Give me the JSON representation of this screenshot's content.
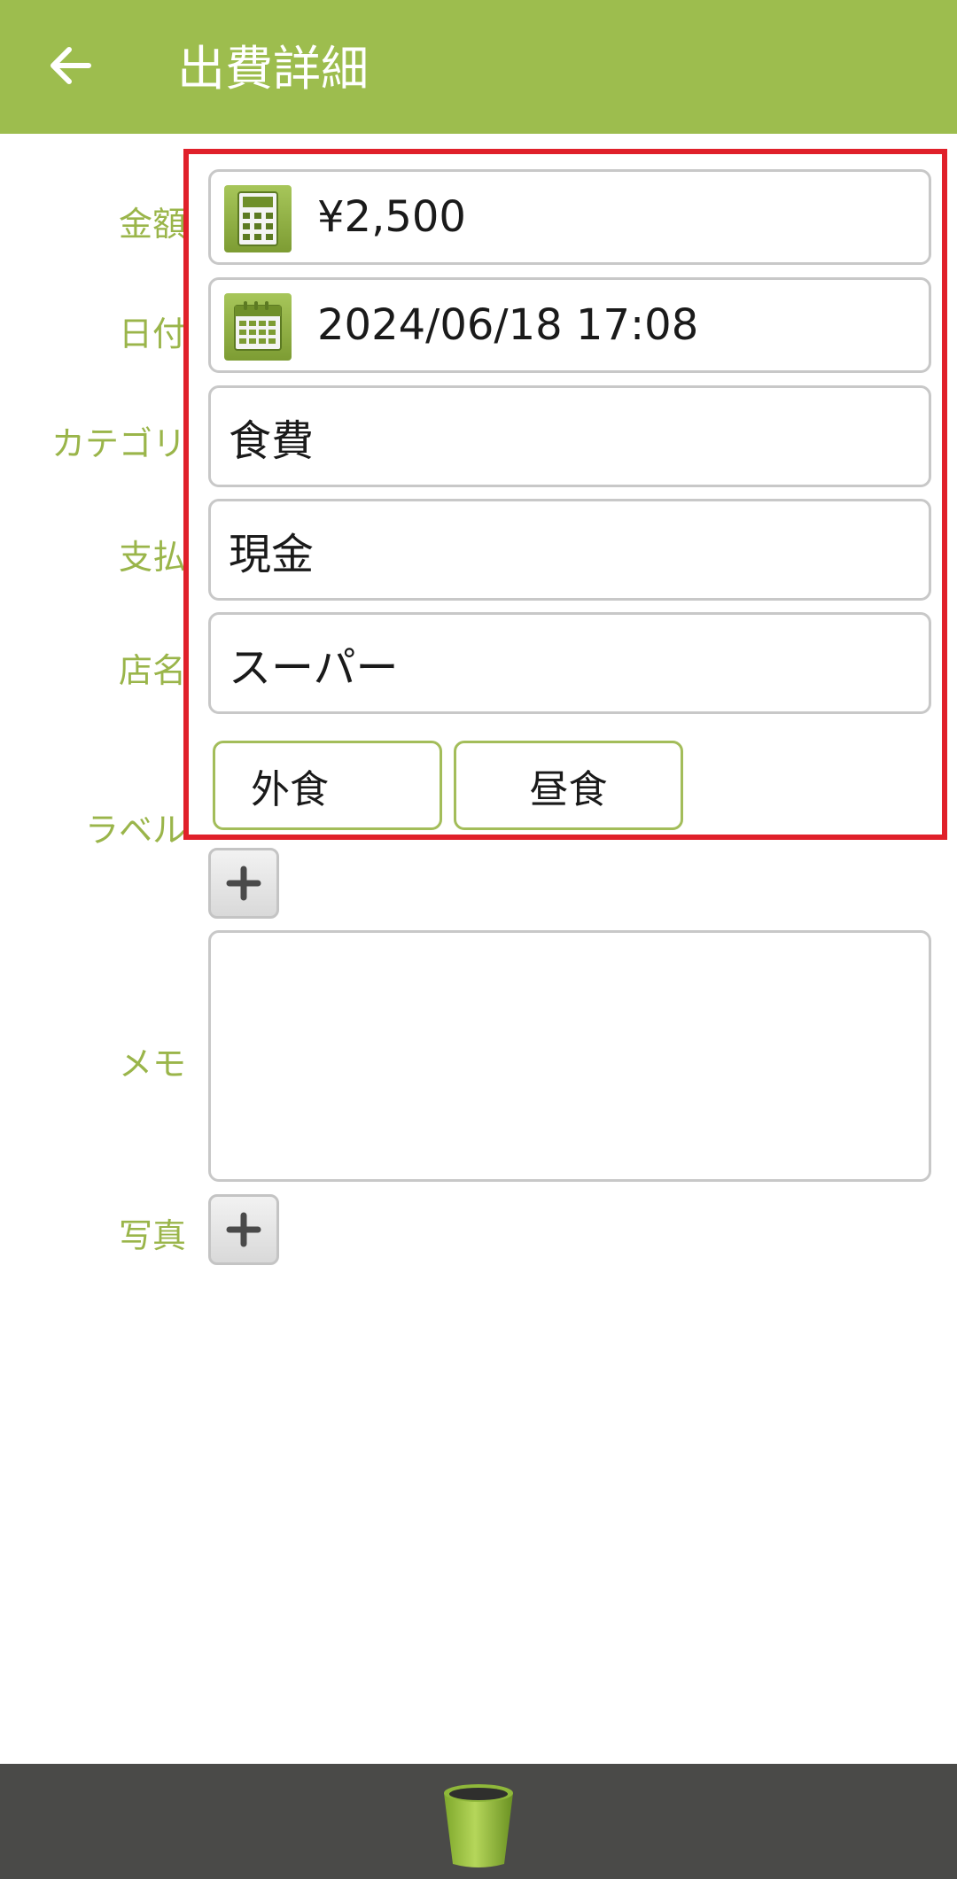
{
  "header": {
    "title": "出費詳細",
    "back_icon": "arrow-left-icon",
    "background_color": "#9dbd4e"
  },
  "form": {
    "labels": {
      "amount": "金額",
      "date": "日付",
      "category": "カテゴリ",
      "payment": "支払",
      "store": "店名",
      "label": "ラベル",
      "memo": "メモ",
      "photo": "写真"
    },
    "amount": {
      "value": "¥2,500",
      "icon": "calculator-icon"
    },
    "date": {
      "value": "2024/06/18 17:08",
      "icon": "calendar-icon"
    },
    "category": {
      "value": "食費"
    },
    "payment": {
      "value": "現金"
    },
    "store": {
      "value": "スーパー"
    },
    "tags": [
      "外食",
      "昼食"
    ],
    "add_label_icon": "plus-icon",
    "memo": {
      "value": ""
    },
    "add_photo_icon": "plus-icon"
  },
  "highlight_color": "#e0202a",
  "footer": {
    "delete_icon": "trash-can-icon",
    "background_color": "#4a4a48"
  }
}
